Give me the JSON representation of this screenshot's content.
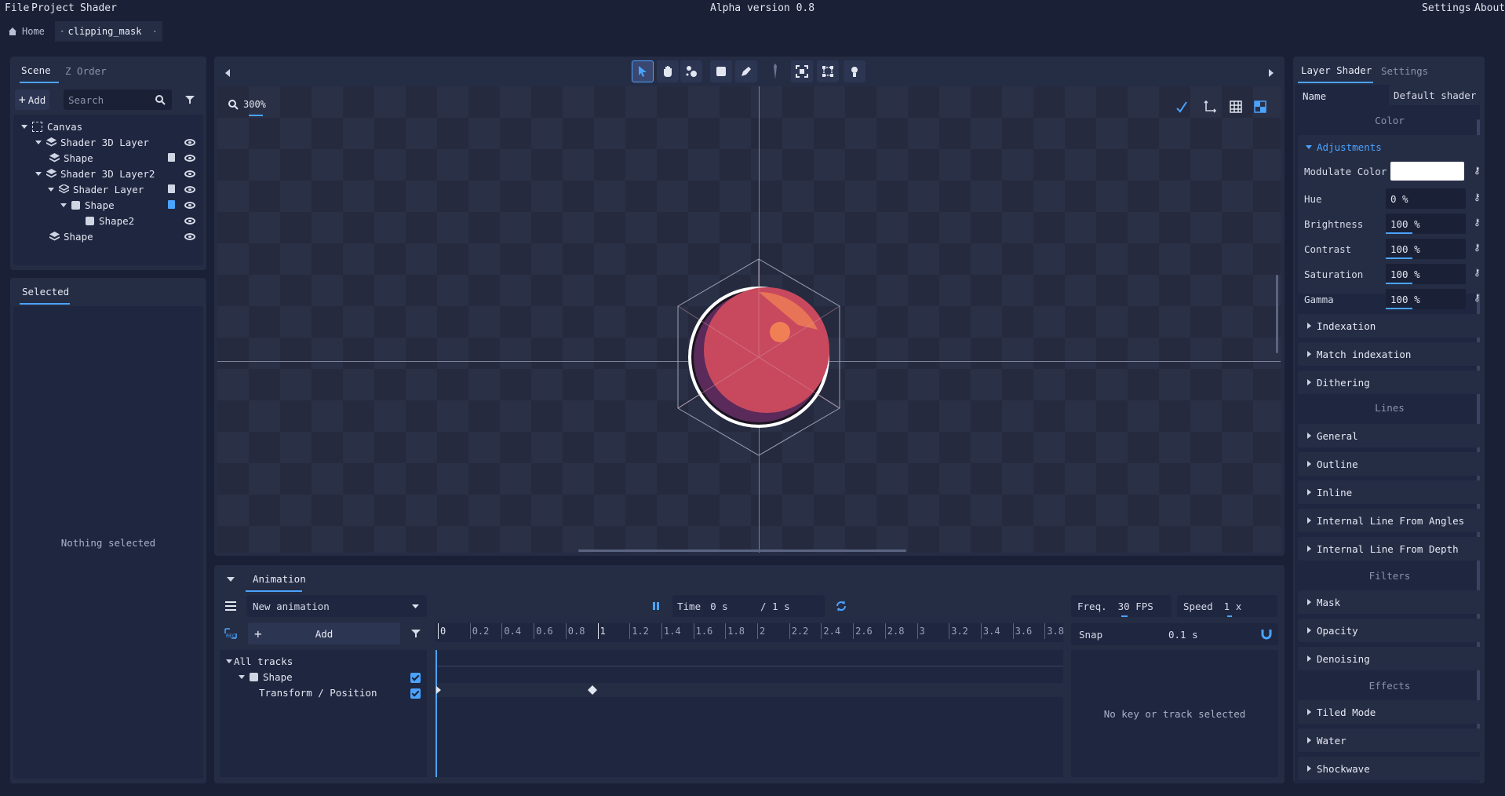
{
  "menubar": {
    "file": "File",
    "project": "Project",
    "shader": "Shader",
    "title": "Alpha version 0.8",
    "settings": "Settings",
    "about": "About"
  },
  "tabs": [
    {
      "label": "Home"
    },
    {
      "label": "clipping_mask"
    }
  ],
  "scene_panel": {
    "tabs": [
      "Scene",
      "Z Order"
    ],
    "add_label": "Add",
    "search_placeholder": "Search",
    "tree": [
      {
        "label": "Canvas"
      },
      {
        "label": "Shader 3D Layer"
      },
      {
        "label": "Shape"
      },
      {
        "label": "Shader 3D Layer2"
      },
      {
        "label": "Shader Layer"
      },
      {
        "label": "Shape"
      },
      {
        "label": "Shape2"
      },
      {
        "label": "Shape"
      }
    ]
  },
  "selected_panel": {
    "tab": "Selected",
    "empty_text": "Nothing selected"
  },
  "viewport": {
    "zoom": "300%"
  },
  "animation": {
    "tab": "Animation",
    "animation_name": "New animation",
    "time_label": "Time",
    "time_value": "0 s",
    "duration": "/ 1 s",
    "freq_label": "Freq.",
    "freq_value": "30 FPS",
    "speed_label": "Speed",
    "speed_value": "1 x",
    "add_label": "Add",
    "snap_label": "Snap",
    "snap_value": "0.1 s",
    "ticks": [
      "0",
      "0.2",
      "0.4",
      "0.6",
      "0.8",
      "1",
      "1.2",
      "1.4",
      "1.6",
      "1.8",
      "2",
      "2.2",
      "2.4",
      "2.6",
      "2.8",
      "3",
      "3.2",
      "3.4",
      "3.6",
      "3.8"
    ],
    "tracks": {
      "all": "All tracks",
      "shape": "Shape",
      "transform": "Transform / Position"
    },
    "empty_text": "No key or track selected"
  },
  "inspector": {
    "tabs": [
      "Layer Shader",
      "Settings"
    ],
    "name_label": "Name",
    "name_value": "Default shader",
    "color_header": "Color",
    "adjustments": "Adjustments",
    "modulate_label": "Modulate Color",
    "modulate_color": "#ffffff",
    "params": [
      {
        "label": "Hue",
        "value": "0 %",
        "fraction": 0.0
      },
      {
        "label": "Brightness",
        "value": "100 %",
        "fraction": 0.33
      },
      {
        "label": "Contrast",
        "value": "100 %",
        "fraction": 0.33
      },
      {
        "label": "Saturation",
        "value": "100 %",
        "fraction": 0.33
      },
      {
        "label": "Gamma",
        "value": "100 %",
        "fraction": 0.33
      }
    ],
    "color_sections": [
      "Indexation",
      "Match indexation",
      "Dithering"
    ],
    "lines_header": "Lines",
    "lines_sections": [
      "General",
      "Outline",
      "Inline",
      "Internal Line From Angles",
      "Internal Line From Depth"
    ],
    "filters_header": "Filters",
    "filters_sections": [
      "Mask",
      "Opacity",
      "Denoising"
    ],
    "effects_header": "Effects",
    "effects_sections": [
      "Tiled Mode",
      "Water",
      "Shockwave"
    ]
  },
  "colors": {
    "accent": "#4aa3ff",
    "bg": "#1a2035",
    "panel": "#252d45",
    "sphere": "#c8495e",
    "sphere_shadow": "#5a2a5a",
    "highlight": "#f07f55"
  }
}
